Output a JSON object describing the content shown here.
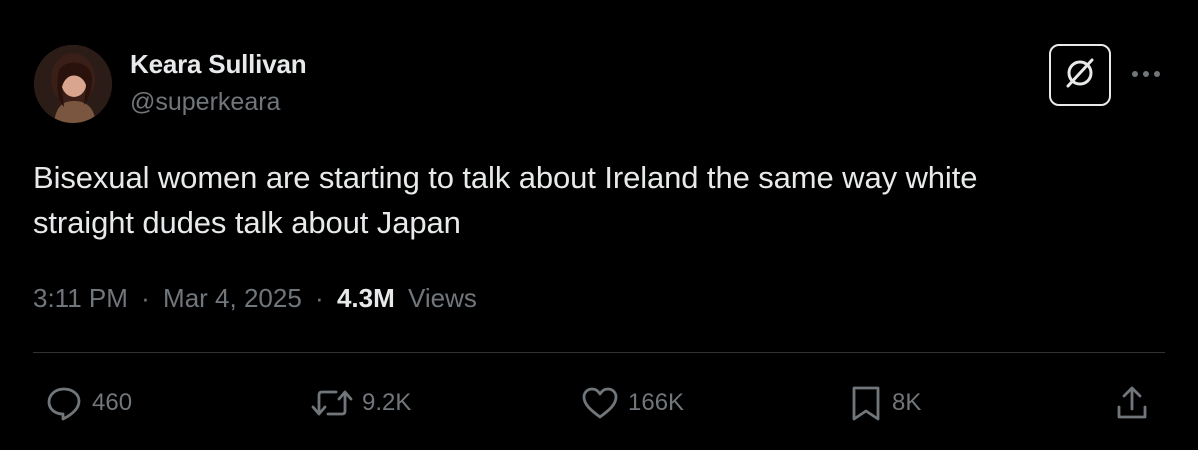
{
  "author": {
    "name": "Keara Sullivan",
    "handle": "@superkeara"
  },
  "tweet": {
    "text_line1": "Bisexual women are starting to talk about Ireland the same way white",
    "text_line2": "straight dudes talk about Japan"
  },
  "meta": {
    "time": "3:11 PM",
    "separator": "·",
    "date": "Mar 4, 2025",
    "views_count": "4.3M",
    "views_label": "Views"
  },
  "actions": {
    "replies": "460",
    "reposts": "9.2K",
    "likes": "166K",
    "bookmarks": "8K"
  },
  "icons": {
    "grok": "grok-icon",
    "more": "more-icon",
    "reply": "reply-icon",
    "repost": "repost-icon",
    "like": "heart-icon",
    "bookmark": "bookmark-icon",
    "share": "share-icon"
  },
  "colors": {
    "background": "#000000",
    "primary_text": "#e7e9ea",
    "secondary_text": "#71767b",
    "divider": "#2f3336"
  }
}
